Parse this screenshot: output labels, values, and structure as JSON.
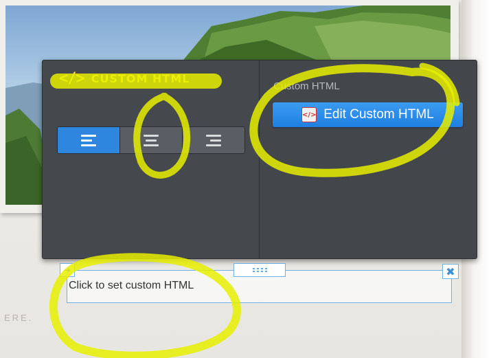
{
  "popup": {
    "title": "CUSTOM HTML",
    "title_icon": "code-icon",
    "title_icon_glyph": "</>",
    "align_buttons": [
      {
        "name": "align-left",
        "icon": "align-left-icon",
        "active": true
      },
      {
        "name": "align-center",
        "icon": "align-center-icon",
        "active": false
      },
      {
        "name": "align-right",
        "icon": "align-right-icon",
        "active": false
      }
    ],
    "right_label": "Custom HTML",
    "edit_button_label": "Edit Custom HTML",
    "edit_button_icon": "html-edit-icon"
  },
  "widget": {
    "placeholder_text": "Click to set custom HTML",
    "move_icon": "arrow-icon",
    "drag_icon": "drag-dots-icon",
    "close_icon": "close-icon",
    "close_glyph": "✖",
    "move_glyph": "➜"
  },
  "background": {
    "footer_text": "ERE."
  },
  "colors": {
    "accent_blue": "#2e86de",
    "highlight_yellow": "#ffe42a",
    "panel_bg": "#45484d"
  }
}
